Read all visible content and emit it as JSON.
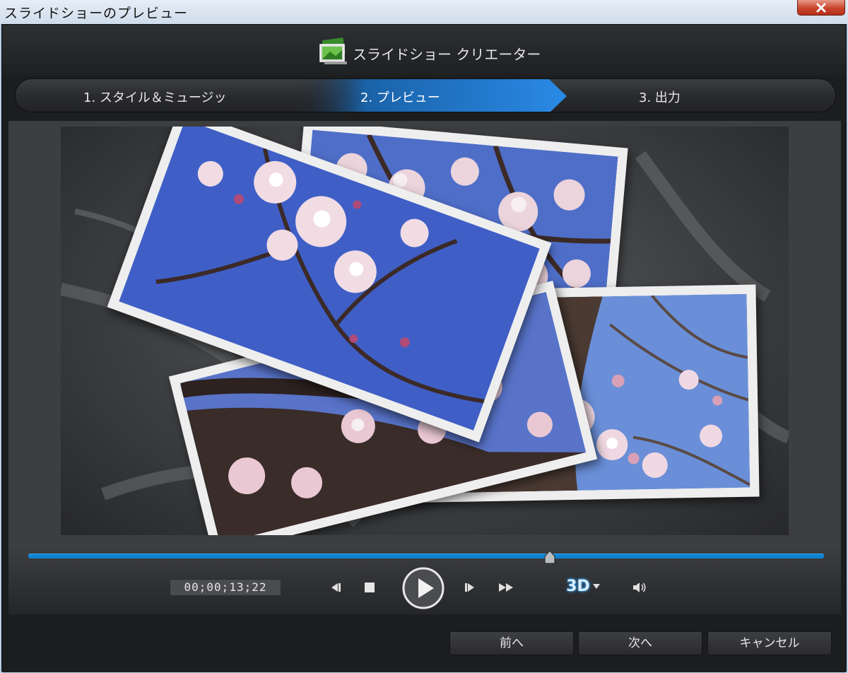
{
  "window": {
    "title": "スライドショーのプレビュー",
    "close_icon": "close-icon"
  },
  "app": {
    "title": "スライドショー クリエーター",
    "logo_icon": "slideshow-logo-icon"
  },
  "steps": [
    {
      "label": "1. スタイル＆ミュージッ",
      "active": false
    },
    {
      "label": "2. プレビュー",
      "active": true
    },
    {
      "label": "3. 出力",
      "active": false
    }
  ],
  "player": {
    "timecode": "00;00;13;22",
    "progress": 0.655,
    "mode_label": "3D",
    "accent_color": "#0d84d4"
  },
  "footer": {
    "prev_label": "前へ",
    "next_label": "次へ",
    "cancel_label": "キャンセル"
  }
}
